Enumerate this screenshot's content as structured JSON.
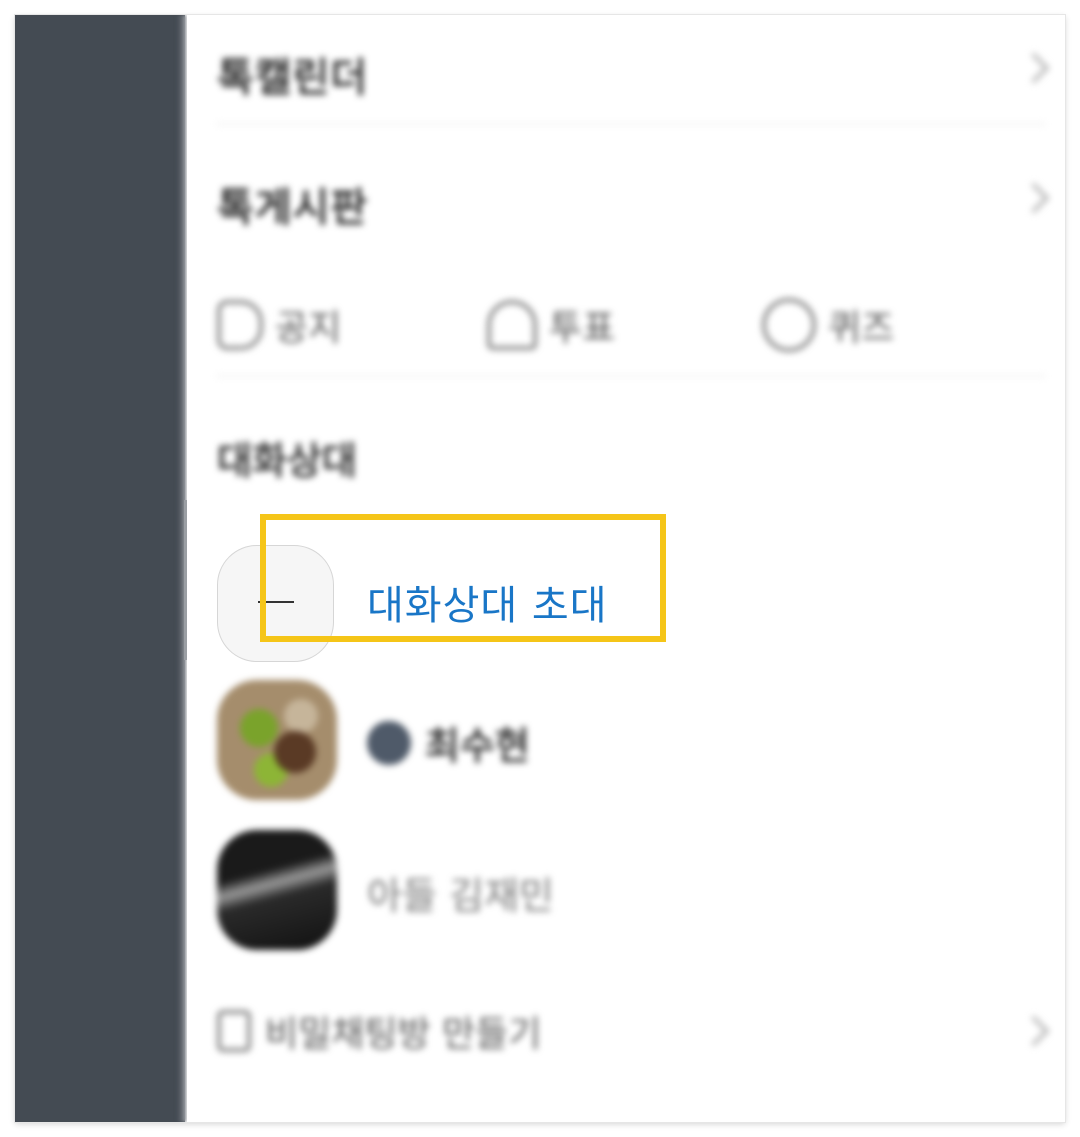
{
  "menu": {
    "row1_title": "톡캘린더",
    "row2_title": "톡게시판"
  },
  "actions": [
    {
      "label": "공지",
      "icon": "megaphone-icon"
    },
    {
      "label": "투표",
      "icon": "vote-box-icon"
    },
    {
      "label": "퀴즈",
      "icon": "quiz-icon"
    }
  ],
  "members": {
    "section_title": "대화상대",
    "invite_label": "대화상대 초대",
    "friends": [
      {
        "name": "최수현"
      },
      {
        "name": "아들 김재민"
      }
    ]
  },
  "secret_chat": {
    "label": "비밀채팅방 만들기"
  },
  "colors": {
    "accent_blue": "#1976c7",
    "highlight_yellow": "#f5c518",
    "rail_dark": "#444b53"
  }
}
